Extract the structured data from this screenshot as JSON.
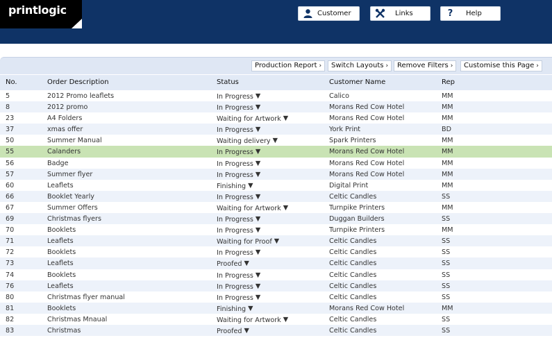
{
  "brand": {
    "name": "printlogic"
  },
  "header_buttons": [
    {
      "label": "Customer",
      "icon": "user-icon"
    },
    {
      "label": "Links",
      "icon": "tools-icon"
    },
    {
      "label": "Help",
      "icon": "help-icon"
    }
  ],
  "toolbar": [
    {
      "label": "Production Report"
    },
    {
      "label": "Switch Layouts"
    },
    {
      "label": "Remove Filters"
    },
    {
      "label": "Customise this Page"
    }
  ],
  "columns": {
    "no": "No.",
    "desc": "Order Description",
    "status": "Status",
    "customer": "Customer Name",
    "rep": "Rep"
  },
  "orders": [
    {
      "no": "5",
      "desc": "2012 Promo leaflets",
      "status": "In Progress",
      "customer": "Calico",
      "rep": "MM"
    },
    {
      "no": "8",
      "desc": "2012 promo",
      "status": "In Progress",
      "customer": "Morans Red Cow Hotel",
      "rep": "MM"
    },
    {
      "no": "23",
      "desc": "A4 Folders",
      "status": "Waiting for Artwork",
      "customer": "Morans Red Cow Hotel",
      "rep": "MM"
    },
    {
      "no": "37",
      "desc": "xmas offer",
      "status": "In Progress",
      "customer": "York Print",
      "rep": "BD"
    },
    {
      "no": "50",
      "desc": "Summer Manual",
      "status": "Waiting delivery",
      "customer": "Spark Printers",
      "rep": "MM"
    },
    {
      "no": "55",
      "desc": "Calanders",
      "status": "In Progress",
      "customer": "Morans Red Cow Hotel",
      "rep": "MM"
    },
    {
      "no": "56",
      "desc": "Badge",
      "status": "In Progress",
      "customer": "Morans Red Cow Hotel",
      "rep": "MM"
    },
    {
      "no": "57",
      "desc": "Summer flyer",
      "status": "In Progress",
      "customer": "Morans Red Cow Hotel",
      "rep": "MM"
    },
    {
      "no": "60",
      "desc": "Leaflets",
      "status": "Finishing",
      "customer": "Digital Print",
      "rep": "MM"
    },
    {
      "no": "66",
      "desc": "Booklet Yearly",
      "status": "In Progress",
      "customer": "Celtic Candles",
      "rep": "SS"
    },
    {
      "no": "67",
      "desc": "Summer Offers",
      "status": "Waiting for Artwork",
      "customer": "Turnpike Printers",
      "rep": "MM"
    },
    {
      "no": "69",
      "desc": "Christmas flyers",
      "status": "In Progress",
      "customer": "Duggan Builders",
      "rep": "SS"
    },
    {
      "no": "70",
      "desc": "Booklets",
      "status": "In Progress",
      "customer": "Turnpike Printers",
      "rep": "MM"
    },
    {
      "no": "71",
      "desc": "Leaflets",
      "status": "Waiting for Proof",
      "customer": "Celtic Candles",
      "rep": "SS"
    },
    {
      "no": "72",
      "desc": "Booklets",
      "status": "In Progress",
      "customer": "Celtic Candles",
      "rep": "SS"
    },
    {
      "no": "73",
      "desc": "Leaflets",
      "status": "Proofed",
      "customer": "Celtic Candles",
      "rep": "SS"
    },
    {
      "no": "74",
      "desc": "Booklets",
      "status": "In Progress",
      "customer": "Celtic Candles",
      "rep": "SS"
    },
    {
      "no": "76",
      "desc": "Leaflets",
      "status": "In Progress",
      "customer": "Celtic Candles",
      "rep": "SS"
    },
    {
      "no": "80",
      "desc": "Christmas flyer manual",
      "status": "In Progress",
      "customer": "Celtic Candles",
      "rep": "SS"
    },
    {
      "no": "81",
      "desc": "Booklets",
      "status": "Finishing",
      "customer": "Morans Red Cow Hotel",
      "rep": "MM"
    },
    {
      "no": "82",
      "desc": "Christmas Mnaual",
      "status": "Waiting for Artwork",
      "customer": "Celtic Candles",
      "rep": "SS"
    },
    {
      "no": "83",
      "desc": "Christmas",
      "status": "Proofed",
      "customer": "Celtic Candles",
      "rep": "SS"
    }
  ],
  "highlighted_row_no": "55",
  "colors": {
    "header": "#0f3366",
    "toolbar": "#dfe7f4",
    "row_alt": "#edf2fa",
    "row_highlight": "#c9e3b4"
  }
}
